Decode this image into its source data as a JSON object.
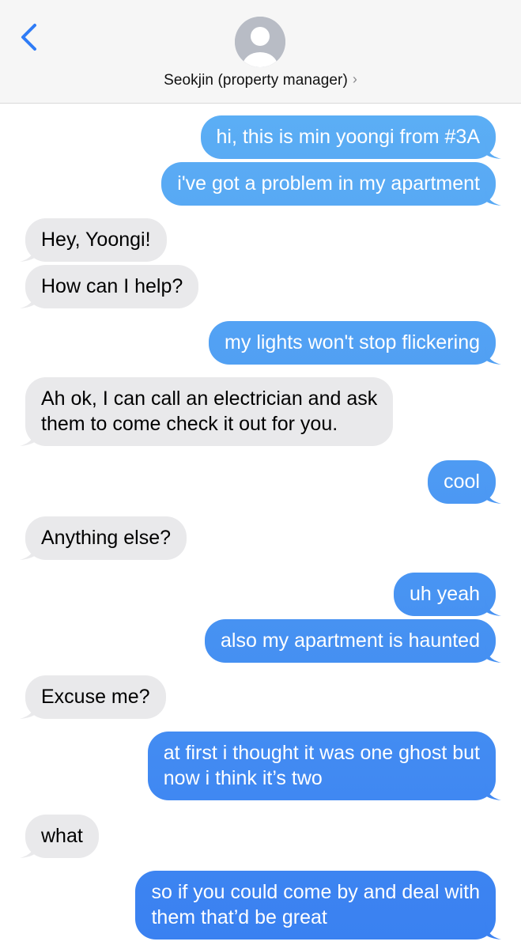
{
  "header": {
    "contact_name": "Seokjin (property manager)",
    "chevron": "›",
    "back_icon": "chevron-left-icon",
    "avatar_icon": "person-silhouette-icon"
  },
  "colors": {
    "outgoing_top": "#60b4f5",
    "outgoing_bottom": "#3a80f1",
    "incoming": "#e9e9eb",
    "accent": "#2f7cf6"
  },
  "messages": [
    {
      "sender": "me",
      "lines": [
        "hi, this is min yoongi from #3A"
      ]
    },
    {
      "sender": "me",
      "lines": [
        "i've got a problem in my apartment"
      ]
    },
    {
      "sender": "them",
      "lines": [
        "Hey, Yoongi!"
      ]
    },
    {
      "sender": "them",
      "lines": [
        "How can I help?"
      ]
    },
    {
      "sender": "me",
      "lines": [
        "my lights won't stop flickering"
      ]
    },
    {
      "sender": "them",
      "lines": [
        "Ah ok, I can call an electrician and ask",
        "them to come check it out for you."
      ]
    },
    {
      "sender": "me",
      "lines": [
        "cool"
      ]
    },
    {
      "sender": "them",
      "lines": [
        "Anything else?"
      ]
    },
    {
      "sender": "me",
      "lines": [
        "uh yeah"
      ]
    },
    {
      "sender": "me",
      "lines": [
        "also my apartment is haunted"
      ]
    },
    {
      "sender": "them",
      "lines": [
        "Excuse me?"
      ]
    },
    {
      "sender": "me",
      "lines": [
        "at first i thought it was one ghost but",
        "now i think it’s two"
      ]
    },
    {
      "sender": "them",
      "lines": [
        "what"
      ]
    },
    {
      "sender": "me",
      "lines": [
        "so if you could come by and deal with",
        "them that’d be great"
      ]
    }
  ]
}
